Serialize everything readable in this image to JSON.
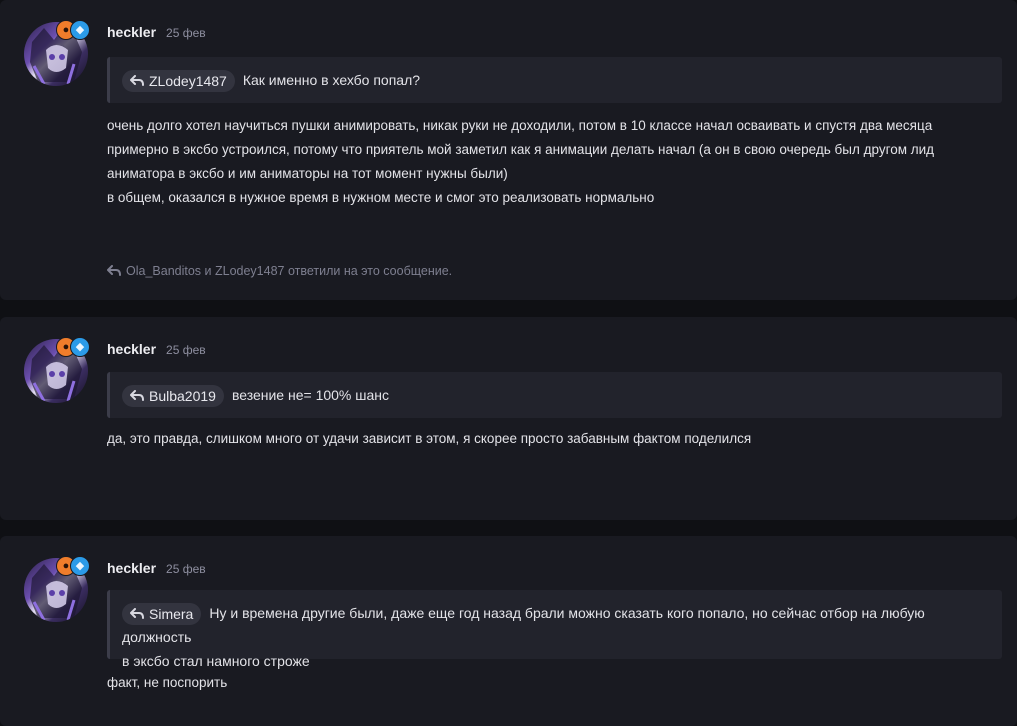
{
  "posts": [
    {
      "author": "heckler",
      "date": "25 фев",
      "quote_user": "ZLodey1487",
      "quote_text": "Как именно в хехбо попал?",
      "body": [
        "очень долго хотел научиться пушки анимировать, никак руки не доходили, потом в 10 классе начал осваивать и спустя два месяца",
        "примерно в эксбо устроился, потому что приятель мой заметил как я анимации делать начал (а он в свою очередь был другом лид",
        "аниматора в эксбо и им аниматоры на тот момент нужны были)",
        "в общем, оказался в нужное время в нужном месте и смог это реализовать нормально"
      ],
      "replies_text": "Ola_Banditos и ZLodey1487 ответили на это сообщение."
    },
    {
      "author": "heckler",
      "date": "25 фев",
      "quote_user": "Bulba2019",
      "quote_text": "везение не= 100% шанс",
      "body": [
        "да, это правда, слишком много от удачи зависит в этом, я скорее просто забавным фактом поделился"
      ]
    },
    {
      "author": "heckler",
      "date": "25 фев",
      "quote_user": "Simera",
      "quote_text": "Ну и времена другие были, даже еще год назад брали можно сказать кого попало, но сейчас отбор на любую должность",
      "quote_text_2": "в эксбо стал намного строже",
      "body": [
        "факт, не поспорить"
      ]
    }
  ],
  "icons": {
    "reply": "reply-arrow-icon",
    "badge_1": "orange-badge-icon",
    "badge_2": "diamond-badge-icon"
  },
  "colors": {
    "background": "#0f1014",
    "card": "#191a21",
    "quote": "#22232c",
    "badge_orange": "#f07d2b",
    "badge_blue": "#2b9be8"
  }
}
